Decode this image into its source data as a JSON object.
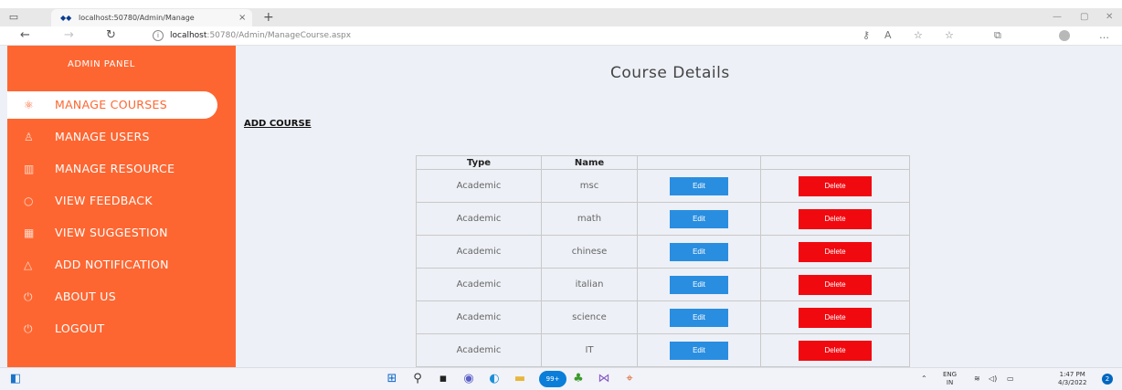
{
  "browser": {
    "tab_title": "localhost:50780/Admin/Manage",
    "tab_close": "×",
    "new_tab": "+",
    "url_host": "localhost",
    "url_rest": ":50780/Admin/ManageCourse.aspx",
    "icons": [
      "tab-actions-icon",
      "favicon-icon",
      "back-icon",
      "forward-icon",
      "refresh-icon",
      "info-icon",
      "key-icon",
      "read-aloud-icon",
      "favorite-add-icon",
      "favorites-icon",
      "collections-icon",
      "profile-icon",
      "more-icon"
    ]
  },
  "sidebar": {
    "title": "ADMIN PANEL",
    "items": [
      {
        "label": "MANAGE COURSES",
        "icon": "atom-icon",
        "active": true
      },
      {
        "label": "MANAGE USERS",
        "icon": "user-icon",
        "active": false
      },
      {
        "label": "MANAGE RESOURCE",
        "icon": "book-icon",
        "active": false
      },
      {
        "label": "VIEW FEEDBACK",
        "icon": "chat-icon",
        "active": false
      },
      {
        "label": "VIEW SUGGESTION",
        "icon": "building-icon",
        "active": false
      },
      {
        "label": "ADD NOTIFICATION",
        "icon": "bell-icon",
        "active": false
      },
      {
        "label": "ABOUT US",
        "icon": "power-icon",
        "active": false
      },
      {
        "label": "LOGOUT",
        "icon": "power-icon",
        "active": false
      }
    ]
  },
  "main": {
    "page_title": "Course Details",
    "add_course_link": "ADD COURSE",
    "table": {
      "headers": [
        "Type",
        "Name",
        "",
        ""
      ],
      "rows": [
        {
          "type": "Academic",
          "name": "msc"
        },
        {
          "type": "Academic",
          "name": "math"
        },
        {
          "type": "Academic",
          "name": "chinese"
        },
        {
          "type": "Academic",
          "name": "italian"
        },
        {
          "type": "Academic",
          "name": "science"
        },
        {
          "type": "Academic",
          "name": "IT"
        }
      ],
      "edit_label": "Edit",
      "delete_label": "Delete"
    },
    "colors": {
      "sidebar": "#fe6631",
      "edit": "#2a8ee0",
      "delete": "#f00a10",
      "background": "#edf0f6"
    }
  },
  "taskbar": {
    "badge": "99+",
    "lang_top": "ENG",
    "lang_bottom": "IN",
    "time": "1:47 PM",
    "date": "4/3/2022",
    "notification_count": "2"
  }
}
